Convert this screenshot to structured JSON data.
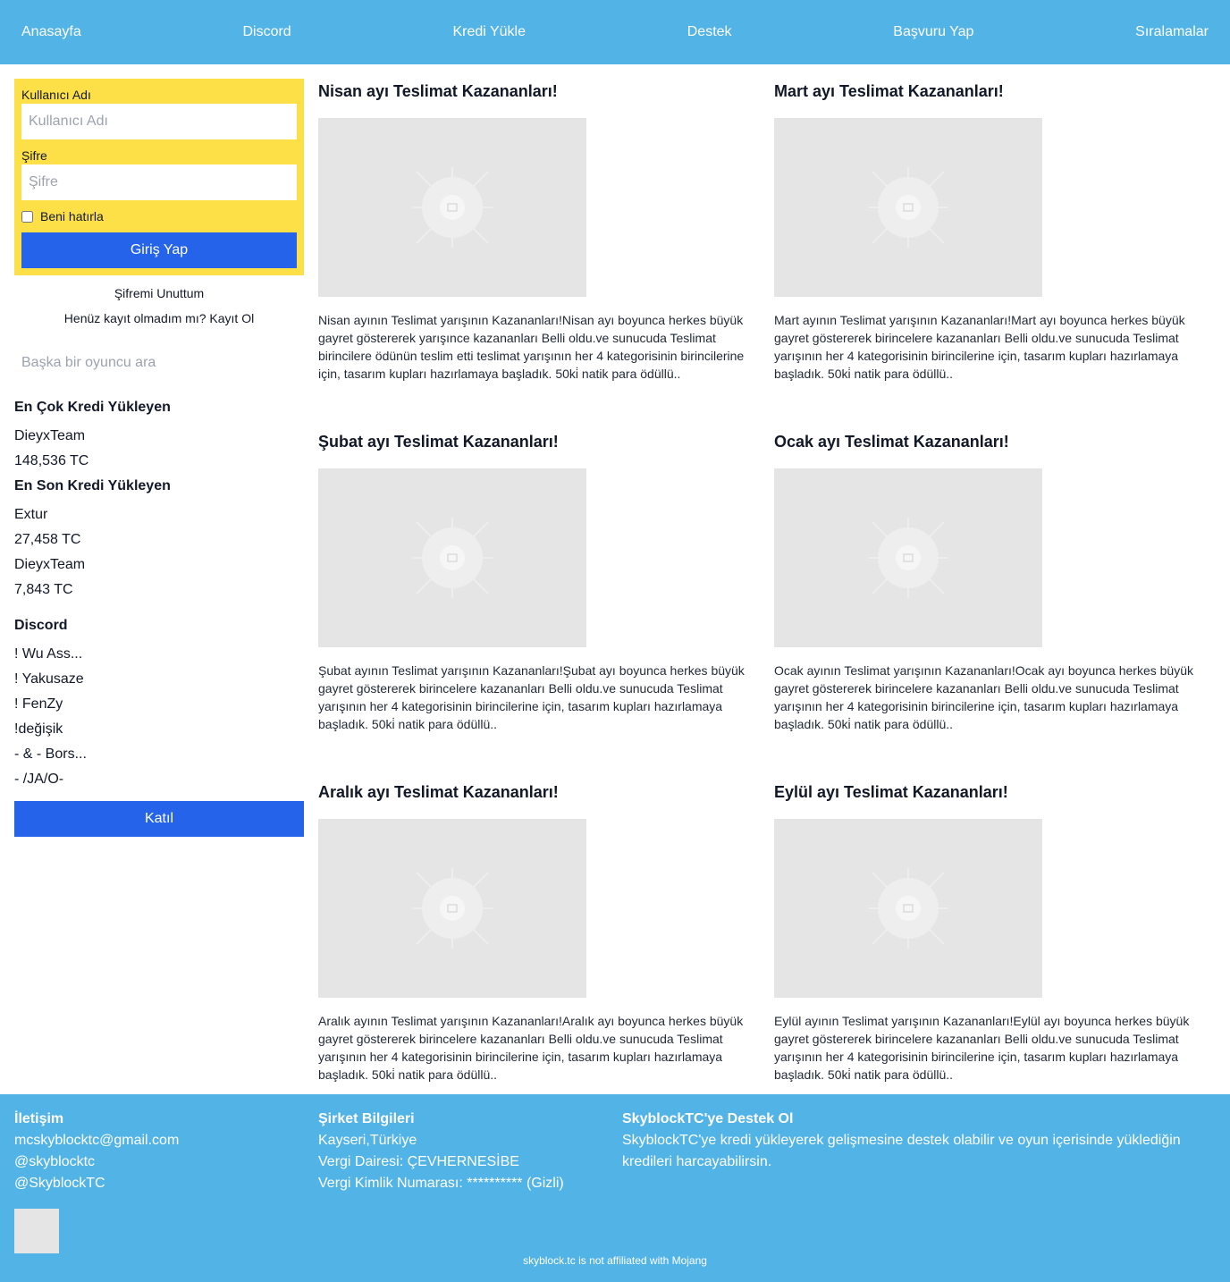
{
  "nav": {
    "items": [
      {
        "label": "Anasayfa"
      },
      {
        "label": "Discord"
      },
      {
        "label": "Kredi Yükle"
      },
      {
        "label": "Destek"
      },
      {
        "label": "Başvuru Yap"
      },
      {
        "label": "Sıralamalar"
      }
    ]
  },
  "login": {
    "username_label": "Kullanıcı Adı",
    "username_placeholder": "Kullanıcı Adı",
    "username_value": "",
    "password_label": "Şifre",
    "password_placeholder": "Şifre",
    "password_value": "",
    "remember_label": "Beni hatırla",
    "submit_label": "Giriş Yap",
    "forgot_label": "Şifremi Unuttum",
    "register_label": "Henüz kayıt olmadım mı? Kayıt Ol"
  },
  "player_search": {
    "placeholder": "Başka bir oyuncu ara",
    "value": ""
  },
  "top_loader": {
    "heading": "En Çok Kredi Yükleyen",
    "name": "DieyxTeam",
    "amount": "148,536 TC"
  },
  "recent_loaders": {
    "heading": "En Son Kredi Yükleyen",
    "items": [
      {
        "name": "Extur",
        "amount": "27,458 TC"
      },
      {
        "name": "DieyxTeam",
        "amount": "7,843 TC"
      }
    ]
  },
  "discord": {
    "heading": "Discord",
    "members": [
      "! Wu Ass...",
      "! Yakusaze",
      "! FenZy",
      "!değişik",
      "- & - Bors...",
      "- /JA/O-"
    ],
    "join_label": "Katıl"
  },
  "posts": [
    {
      "title": "Nisan ayı Teslimat Kazananları!",
      "text": "Nisan ayının Teslimat yarışının Kazananları!Nisan ayı boyunca herkes büyük gayret göstererek yarışınce kazananları Belli oldu.ve sunucuda Teslimat birincilere ödünün teslim etti teslimat yarışının her 4 kategorisinin birincilerine için, tasarım kupları hazırlamaya başladık. 50ki̇ natik para ödüllü..",
      "image_icon": "image-placeholder-icon"
    },
    {
      "title": "Mart ayı Teslimat Kazananları!",
      "text": "Mart ayının Teslimat yarışının Kazananları!Mart ayı boyunca herkes büyük gayret göstererek birincelere kazananları Belli oldu.ve sunucuda Teslimat yarışının her 4 kategorisinin birincilerine için, tasarım kupları hazırlamaya başladık. 50ki̇ natik para ödüllü..",
      "image_icon": "image-placeholder-icon"
    },
    {
      "title": "Şubat ayı Teslimat Kazananları!",
      "text": "Şubat ayının Teslimat yarışının Kazananları!Şubat ayı boyunca herkes büyük gayret göstererek birincelere kazananları Belli oldu.ve sunucuda Teslimat yarışının her 4 kategorisinin birincilerine için, tasarım kupları hazırlamaya başladık. 50ki̇ natik para ödüllü..",
      "image_icon": "image-placeholder-icon"
    },
    {
      "title": "Ocak ayı Teslimat Kazananları!",
      "text": "Ocak ayının Teslimat yarışının Kazananları!Ocak ayı boyunca herkes büyük gayret göstererek birincelere kazananları Belli oldu.ve sunucuda Teslimat yarışının her 4 kategorisinin birincilerine için, tasarım kupları hazırlamaya başladık. 50ki̇ natik para ödüllü..",
      "image_icon": "image-placeholder-icon"
    },
    {
      "title": "Aralık ayı Teslimat Kazananları!",
      "text": "Aralık ayının Teslimat yarışının Kazananları!Aralık ayı boyunca herkes büyük gayret göstererek birincelere kazananları Belli oldu.ve sunucuda Teslimat yarışının her 4 kategorisinin birincilerine için, tasarım kupları hazırlamaya başladık. 50ki̇ natik para ödüllü..",
      "image_icon": "image-placeholder-icon"
    },
    {
      "title": "Eylül ayı Teslimat Kazananları!",
      "text": "Eylül ayının Teslimat yarışının Kazananları!Eylül ayı boyunca herkes büyük gayret göstererek birincelere kazananları Belli oldu.ve sunucuda Teslimat yarışının her 4 kategorisinin birincilerine için, tasarım kupları hazırlamaya başladık. 50ki̇ natik para ödüllü..",
      "image_icon": "image-placeholder-icon"
    }
  ],
  "footer": {
    "contact": {
      "heading": "İletişim",
      "email": "mcskyblocktc@gmail.com",
      "handle1": "@skyblocktc",
      "handle2": "@SkyblockTC"
    },
    "company": {
      "heading": "Şirket Bilgileri",
      "location": "Kayseri,Türkiye",
      "tax_office": "Vergi Dairesi: ÇEVHERNESİBE",
      "tax_number": "Vergi Kimlik Numarası: ********** (Gizli)"
    },
    "support": {
      "heading": "SkyblockTC'ye Destek Ol",
      "text": "SkyblockTC'ye kredi yükleyerek gelişmesine destek olabilir ve oyun içerisinde yüklediğin kredileri harcayabilirsin."
    },
    "note": "skyblock.tc is not affiliated with Mojang"
  },
  "colors": {
    "nav_bg": "#52b3e6",
    "login_bg": "#fde047",
    "button_blue": "#2563eb",
    "image_placeholder": "#e5e5e5"
  }
}
